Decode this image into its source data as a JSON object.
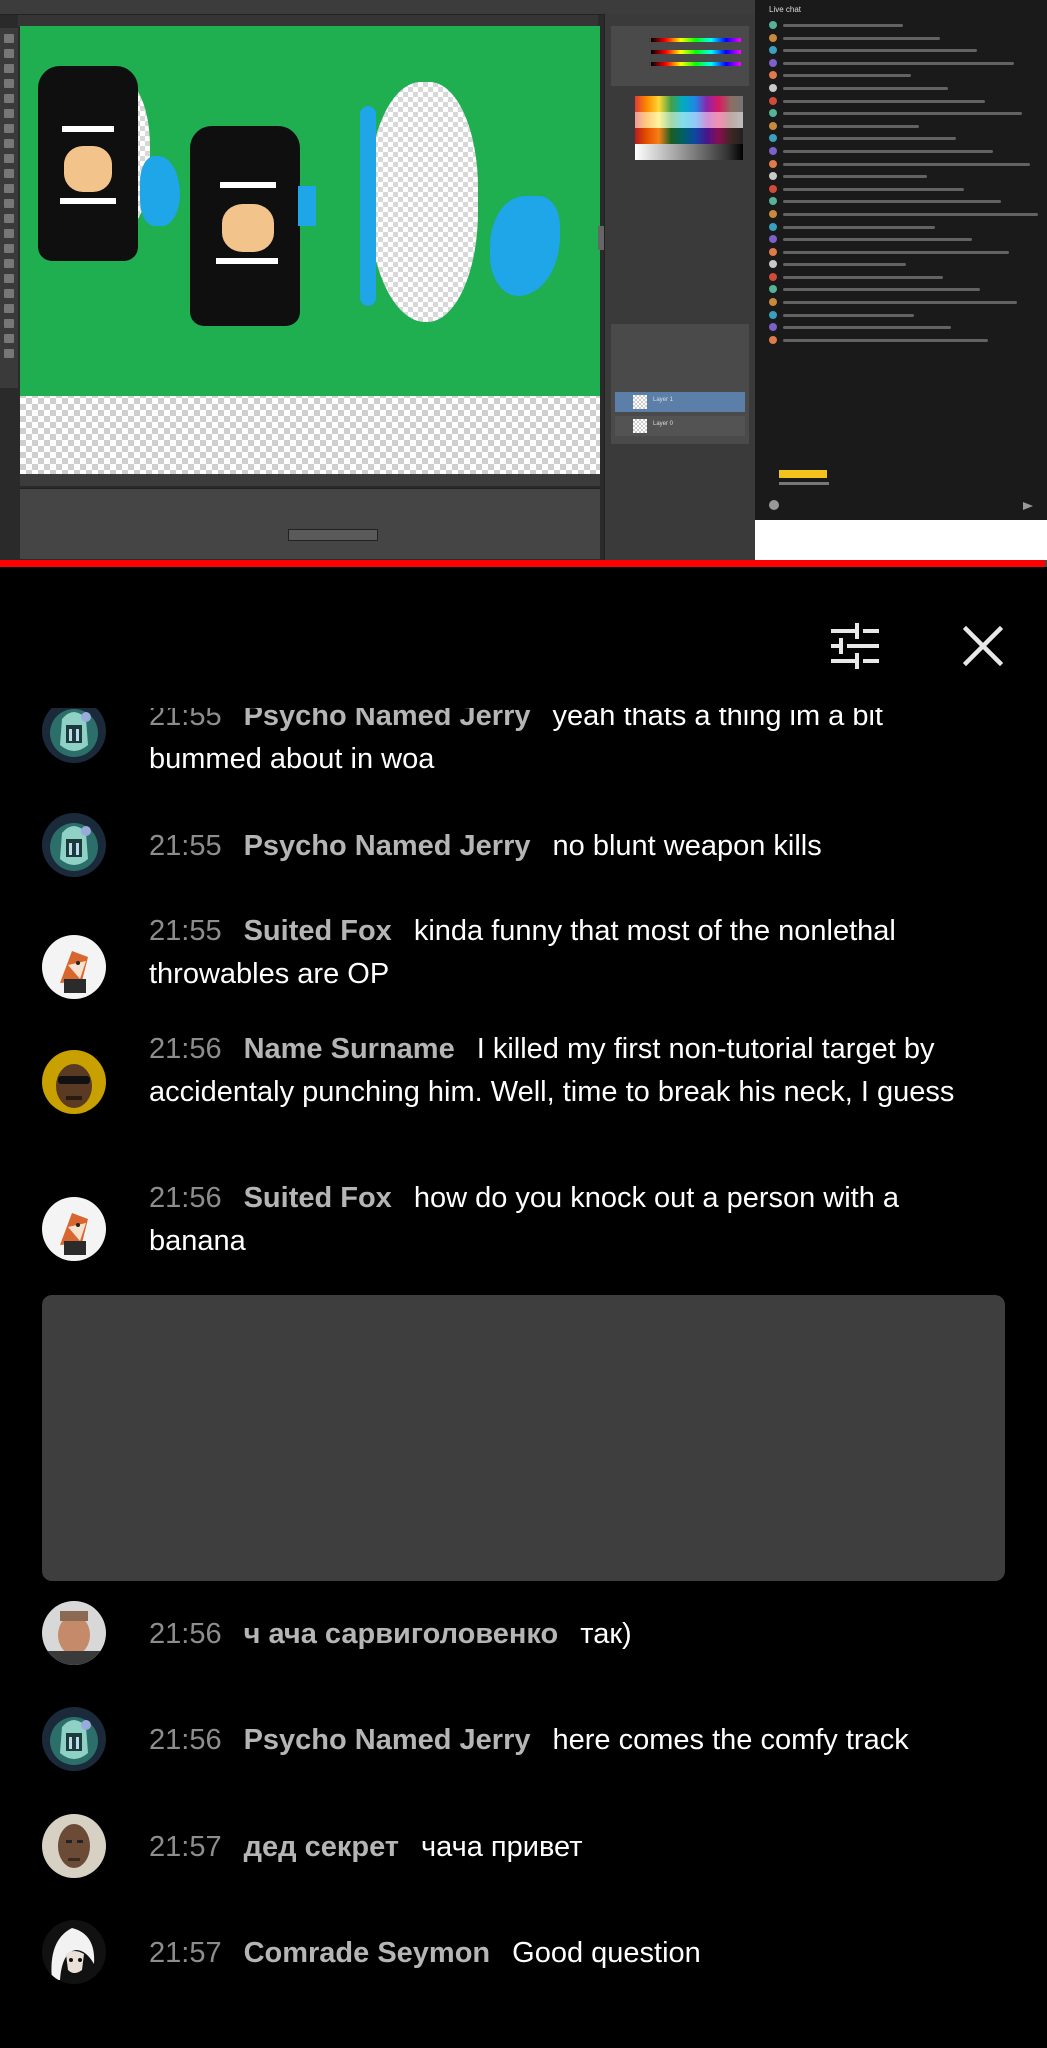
{
  "video": {
    "chat_title": "Live chat",
    "progress_fraction": 0.998
  },
  "header": {
    "filter_icon": "sliders-icon",
    "close_icon": "close-icon"
  },
  "messages": [
    {
      "time": "21:55",
      "author": "Psycho Named Jerry",
      "text": "yeah thats a thing im a bit bummed about in woa",
      "avatar": "jerry"
    },
    {
      "time": "21:55",
      "author": "Psycho Named Jerry",
      "text": "no blunt weapon kills",
      "avatar": "jerry"
    },
    {
      "time": "21:55",
      "author": "Suited Fox",
      "text": "kinda funny that most of the nonlethal throwables are OP",
      "avatar": "fox"
    },
    {
      "time": "21:56",
      "author": "Name Surname",
      "text": "I killed my first non-tutorial target by accidentaly punching him. Well, time to break his neck, I guess",
      "avatar": "surname"
    },
    {
      "time": "21:56",
      "author": "Suited Fox",
      "text": "how do you knock out a person with a banana",
      "avatar": "fox"
    },
    {
      "time": "21:56",
      "author": "ч ача сарвиголовенко",
      "text": "так)",
      "avatar": "chacha"
    },
    {
      "time": "21:56",
      "author": "Psycho Named Jerry",
      "text": "here comes the comfy track",
      "avatar": "jerry"
    },
    {
      "time": "21:57",
      "author": "дед секрет",
      "text": "чача привет",
      "avatar": "ded"
    },
    {
      "time": "21:57",
      "author": "Comrade Seymon",
      "text": "Good question",
      "avatar": "seymon"
    }
  ],
  "colors": {
    "background": "#000000",
    "time": "#8d8d8d",
    "author": "#b5b5b5",
    "message": "#ffffff",
    "pinned_box": "#3e3e3e",
    "progress": "#ff0000"
  }
}
